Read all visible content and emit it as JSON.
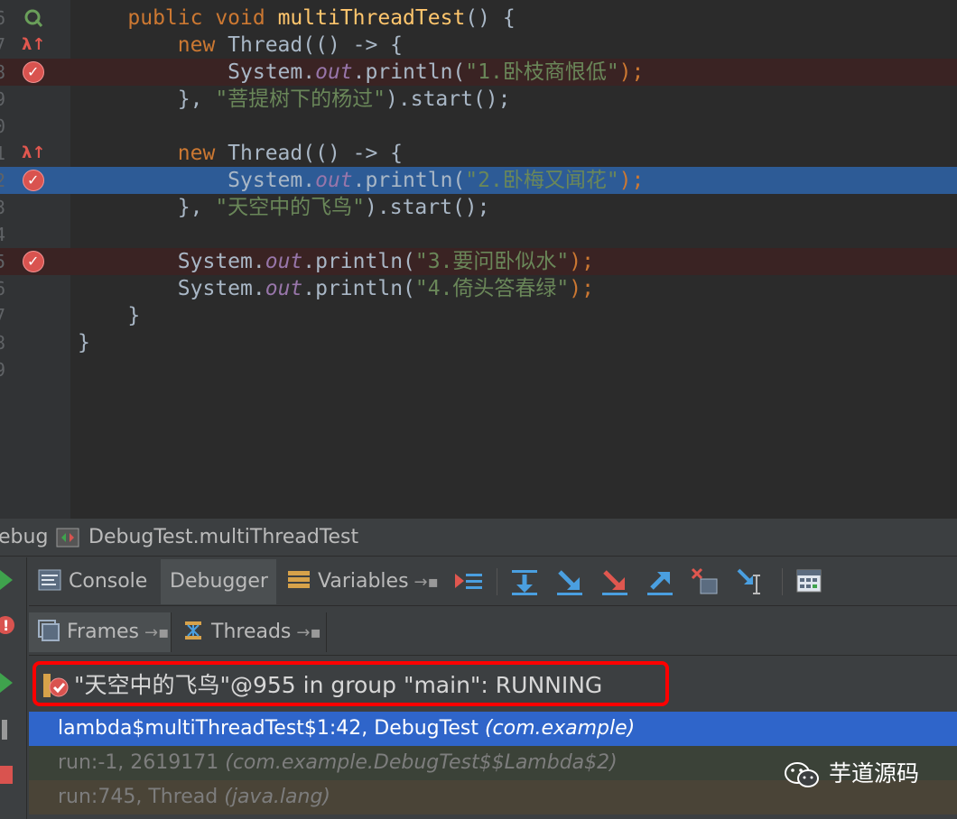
{
  "editor": {
    "line_numbers": [
      "6",
      "7",
      "8",
      "9",
      "0",
      "1",
      "2",
      "3",
      "4",
      "5",
      "6",
      "7",
      "8",
      "9"
    ],
    "lines": [
      {
        "indent": "    ",
        "parts": [
          [
            "kw",
            "public "
          ],
          [
            "kw",
            "void "
          ],
          [
            "fn",
            "multiThreadTest"
          ],
          [
            "p",
            "() {"
          ]
        ]
      },
      {
        "indent": "        ",
        "parts": [
          [
            "kw",
            "new "
          ],
          [
            "p",
            "Thread(() -> {"
          ]
        ]
      },
      {
        "indent": "            ",
        "parts": [
          [
            "p",
            "System."
          ],
          [
            "fld",
            "out"
          ],
          [
            "p",
            ".println("
          ],
          [
            "str",
            "\"1.卧枝商恨低\""
          ],
          [
            "p",
            ");"
          ]
        ]
      },
      {
        "indent": "        ",
        "parts": [
          [
            "p",
            "}, "
          ],
          [
            "str",
            "\"菩提树下的杨过\""
          ],
          [
            "p",
            ").start();"
          ]
        ]
      },
      {
        "indent": "",
        "parts": []
      },
      {
        "indent": "        ",
        "parts": [
          [
            "kw",
            "new "
          ],
          [
            "p",
            "Thread(() -> {"
          ]
        ]
      },
      {
        "indent": "            ",
        "parts": [
          [
            "p",
            "System."
          ],
          [
            "fld",
            "out"
          ],
          [
            "p",
            ".println("
          ],
          [
            "str",
            "\"2.卧梅又闻花\""
          ],
          [
            "p",
            ");"
          ]
        ]
      },
      {
        "indent": "        ",
        "parts": [
          [
            "p",
            "}, "
          ],
          [
            "str",
            "\"天空中的飞鸟\""
          ],
          [
            "p",
            ").start();"
          ]
        ]
      },
      {
        "indent": "",
        "parts": []
      },
      {
        "indent": "        ",
        "parts": [
          [
            "p",
            "System."
          ],
          [
            "fld",
            "out"
          ],
          [
            "p",
            ".println("
          ],
          [
            "str",
            "\"3.要问卧似水\""
          ],
          [
            "p",
            ");"
          ]
        ]
      },
      {
        "indent": "        ",
        "parts": [
          [
            "p",
            "System."
          ],
          [
            "fld",
            "out"
          ],
          [
            "p",
            ".println("
          ],
          [
            "str",
            "\"4.倚头答春绿\""
          ],
          [
            "p",
            ");"
          ]
        ]
      },
      {
        "indent": "    ",
        "parts": [
          [
            "p",
            "}"
          ]
        ]
      },
      {
        "indent": "",
        "parts": [
          [
            "p",
            "}"
          ]
        ]
      },
      {
        "indent": "",
        "parts": []
      }
    ]
  },
  "debug": {
    "title_prefix": "ebug",
    "run_config": "DebugTest.multiThreadTest",
    "tabs": {
      "console": "Console",
      "debugger": "Debugger",
      "variables": "Variables"
    },
    "subtabs": {
      "frames": "Frames",
      "threads": "Threads"
    },
    "pin_glyph": "→▪",
    "thread_selector": "\"天空中的飞鸟\"@955 in group \"main\": RUNNING",
    "frames": [
      {
        "method": "lambda$multiThreadTest$1:42, DebugTest ",
        "pkg": "(com.example)"
      },
      {
        "method": "run:-1, 2619171 ",
        "pkg": "(com.example.DebugTest$$Lambda$2)"
      },
      {
        "method": "run:745, Thread ",
        "pkg": "(java.lang)"
      }
    ]
  },
  "watermark": {
    "text": "芋道源码"
  },
  "colors": {
    "breakpoint": "#d9534f",
    "execution_line": "#2d5b96",
    "selected_frame": "#2f65ca",
    "highlight_box": "#ff0000"
  }
}
